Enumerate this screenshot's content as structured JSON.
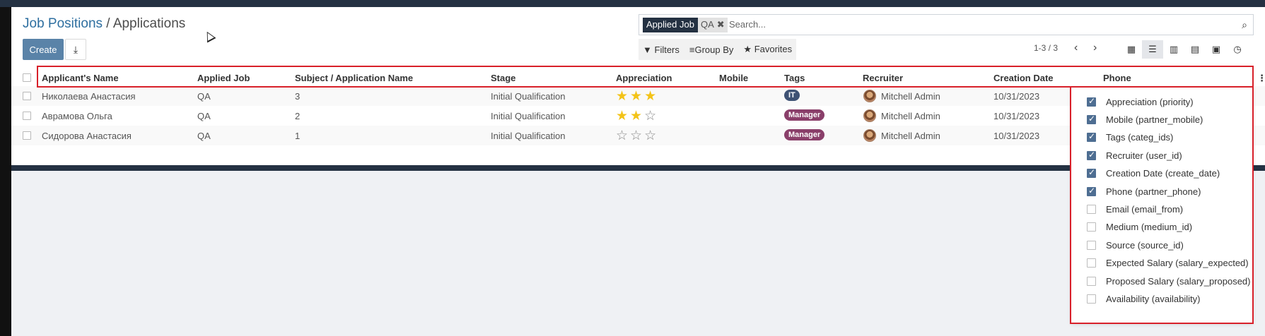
{
  "breadcrumb": {
    "parent": "Job Positions",
    "separator": " / ",
    "current": "Applications"
  },
  "toolbar": {
    "create_label": "Create",
    "download_icon": "download-icon"
  },
  "search": {
    "facet_category": "Applied Job",
    "facet_value": "QA",
    "facet_remove": "✖",
    "placeholder": "Search..."
  },
  "filters": {
    "filters_label": "Filters",
    "groupby_label": "Group By",
    "favorites_label": "Favorites"
  },
  "pager": {
    "text": "1-3 / 3",
    "prev": "‹",
    "next": "›"
  },
  "columns": [
    "Applicant's Name",
    "Applied Job",
    "Subject / Application Name",
    "Stage",
    "Appreciation",
    "Mobile",
    "Tags",
    "Recruiter",
    "Creation Date",
    "Phone"
  ],
  "rows": [
    {
      "name": "Николаева Анастасия",
      "job": "QA",
      "subject": "3",
      "stage": "Initial Qualification",
      "stars": 3,
      "mobile": "",
      "tag": "IT",
      "recruiter": "Mitchell Admin",
      "date": "10/31/2023"
    },
    {
      "name": "Авpамова Ольга",
      "job": "QA",
      "subject": "2",
      "stage": "Initial Qualification",
      "stars": 2,
      "mobile": "",
      "tag": "Manager",
      "recruiter": "Mitchell Admin",
      "date": "10/31/2023"
    },
    {
      "name": "Сидорова Анастасия",
      "job": "QA",
      "subject": "1",
      "stage": "Initial Qualification",
      "stars": 0,
      "mobile": "",
      "tag": "Manager",
      "recruiter": "Mitchell Admin",
      "date": "10/31/2023"
    }
  ],
  "optional_columns": [
    {
      "label": "Appreciation (priority)",
      "checked": true
    },
    {
      "label": "Mobile (partner_mobile)",
      "checked": true
    },
    {
      "label": "Tags (categ_ids)",
      "checked": true
    },
    {
      "label": "Recruiter (user_id)",
      "checked": true
    },
    {
      "label": "Creation Date (create_date)",
      "checked": true
    },
    {
      "label": "Phone (partner_phone)",
      "checked": true
    },
    {
      "label": "Email (email_from)",
      "checked": false
    },
    {
      "label": "Medium (medium_id)",
      "checked": false
    },
    {
      "label": "Source (source_id)",
      "checked": false
    },
    {
      "label": "Expected Salary (salary_expected)",
      "checked": false
    },
    {
      "label": "Proposed Salary (salary_proposed)",
      "checked": false
    },
    {
      "label": "Availability (availability)",
      "checked": false
    }
  ],
  "colors": {
    "primary": "#5a83a8",
    "topbar": "#243142",
    "star": "#f3c317",
    "tag_it": "#3e5274",
    "tag_manager": "#8a3f6a",
    "highlight": "#d8202a"
  }
}
